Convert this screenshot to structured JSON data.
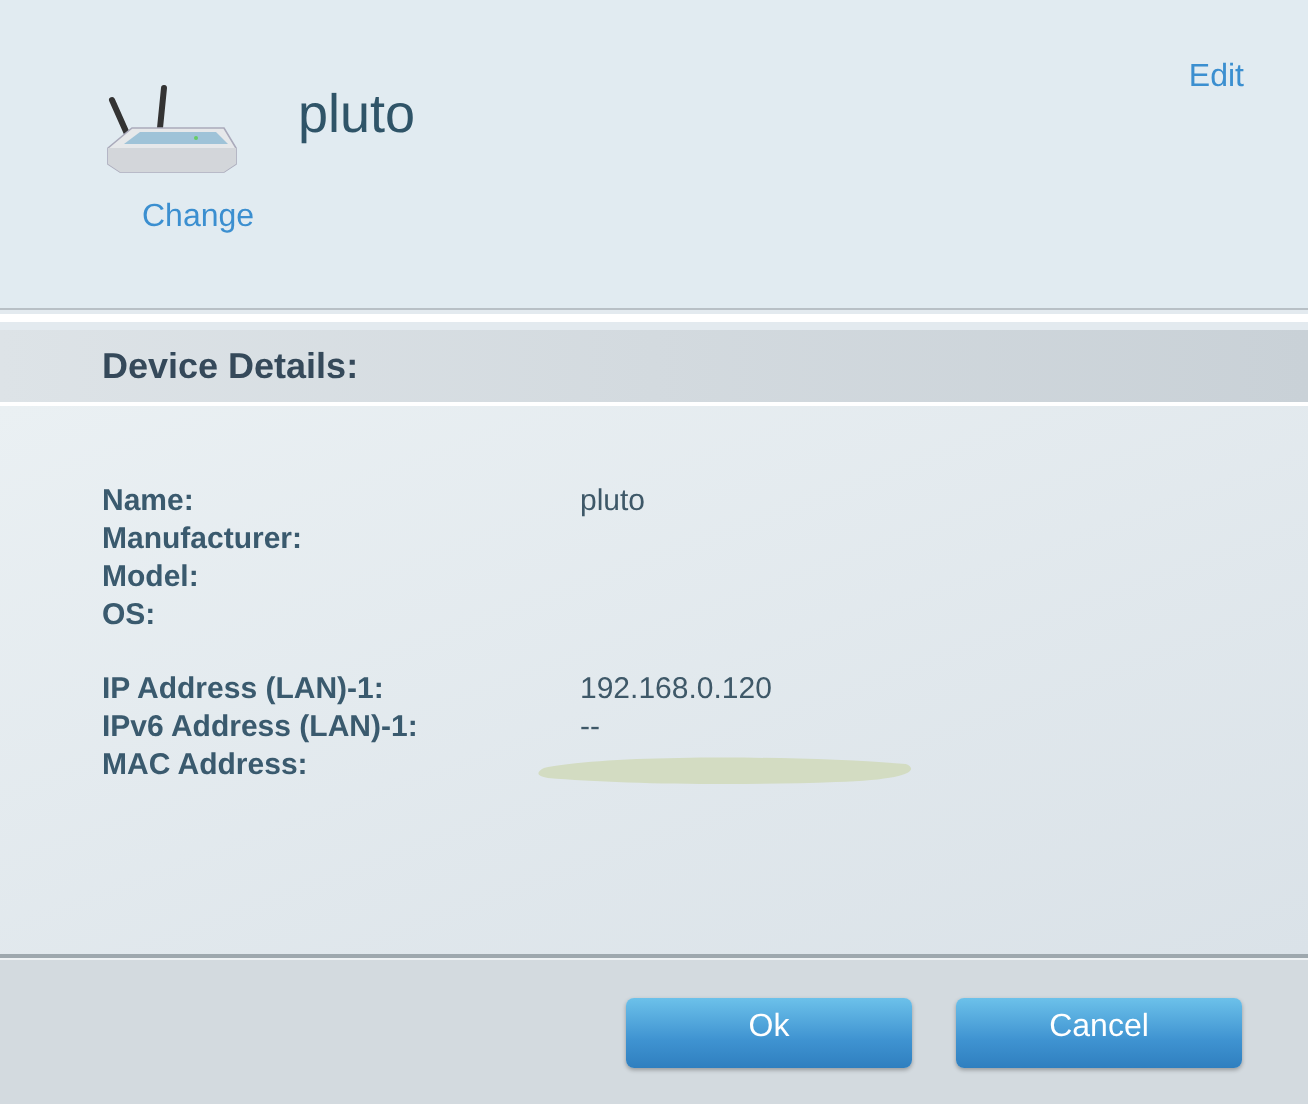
{
  "header": {
    "device_name": "pluto",
    "change_link": "Change",
    "edit_link": "Edit"
  },
  "section": {
    "title": "Device Details:"
  },
  "detail_groups": [
    {
      "rows": [
        {
          "label": "Name:",
          "value": "pluto"
        },
        {
          "label": "Manufacturer:"
        },
        {
          "label": "Model:"
        },
        {
          "label": "OS:"
        }
      ]
    },
    {
      "rows": [
        {
          "label": "IP Address (LAN)-1:",
          "value": "192.168.0.120"
        },
        {
          "label": "IPv6 Address (LAN)-1:",
          "value": "--"
        },
        {
          "label": "MAC Address:",
          "redacted": true
        }
      ]
    }
  ],
  "buttons": [
    "Ok",
    "Cancel"
  ]
}
